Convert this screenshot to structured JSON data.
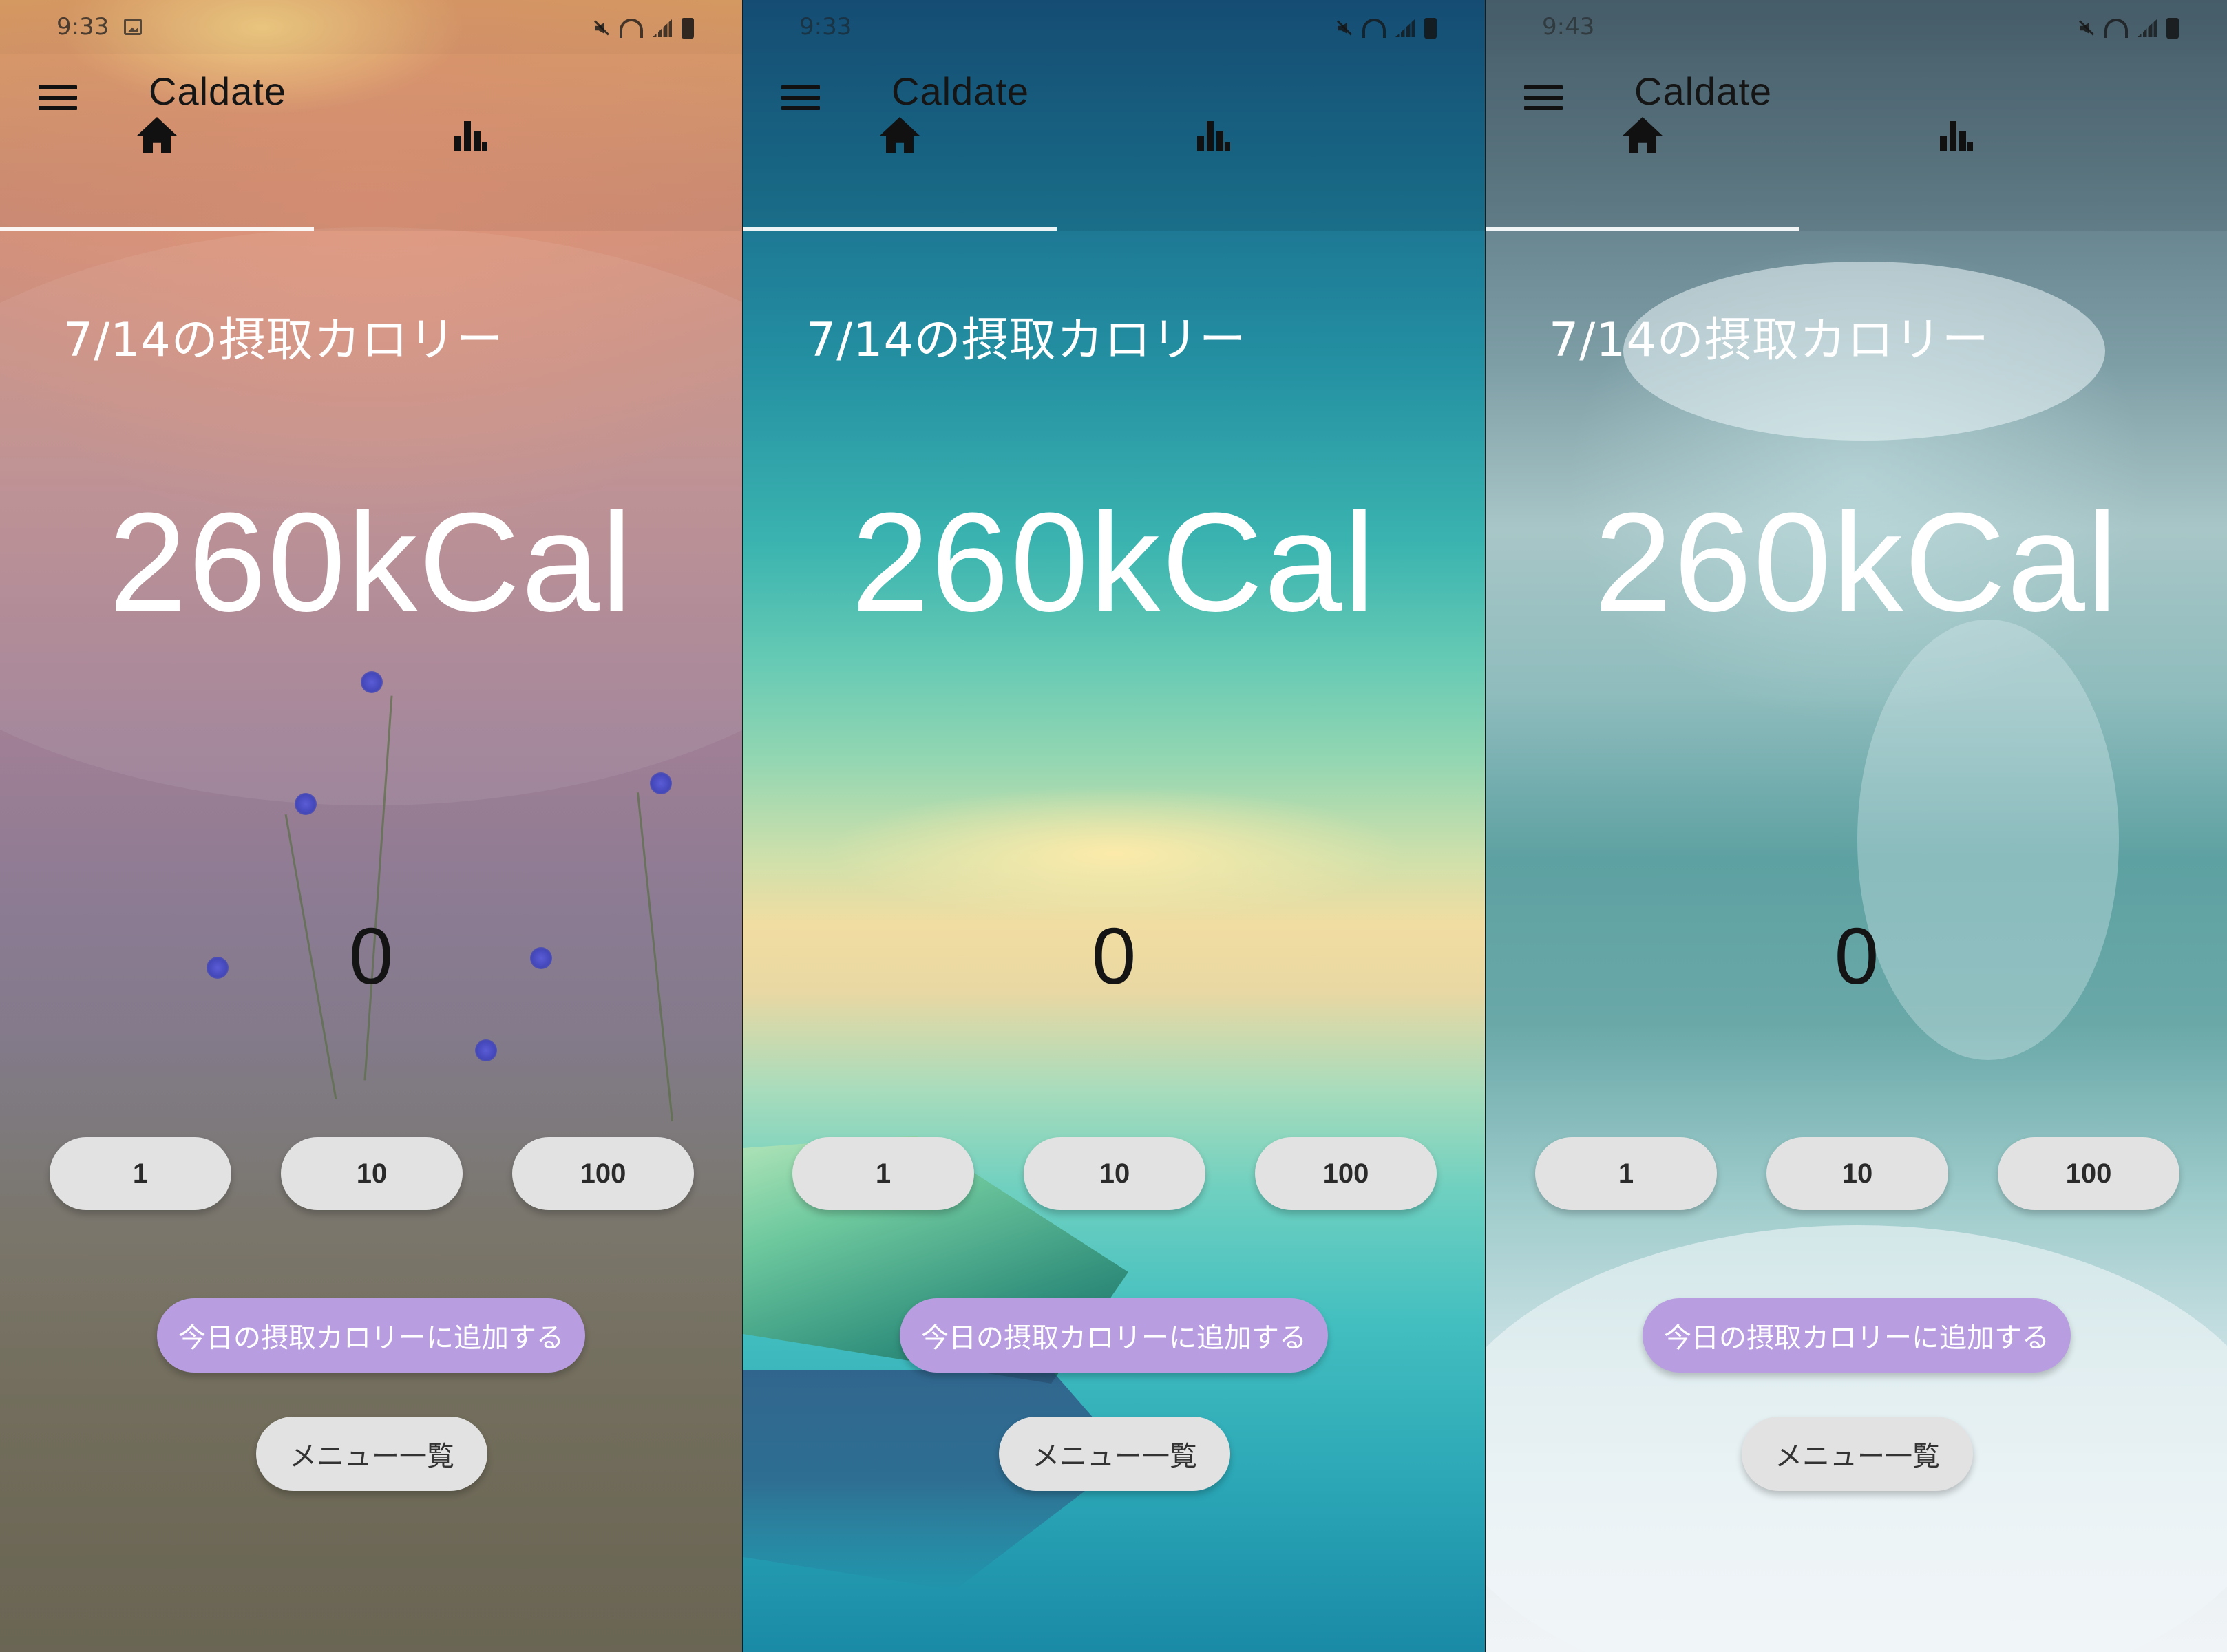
{
  "screens": [
    {
      "status": {
        "time": "9:33"
      },
      "app_title": "Caldate",
      "tabs": [
        {
          "icon": "home-icon"
        },
        {
          "icon": "bar-chart-icon"
        }
      ],
      "heading": "7/14の摂取カロリー",
      "calories": "260kCal",
      "counter": "0",
      "increment_buttons": [
        "1",
        "10",
        "100"
      ],
      "add_button": "今日の摂取カロリーに追加する",
      "menu_button": "メニュー一覧",
      "background": "sunset-flower-field"
    },
    {
      "status": {
        "time": "9:33"
      },
      "app_title": "Caldate",
      "tabs": [
        {
          "icon": "home-icon"
        },
        {
          "icon": "bar-chart-icon"
        }
      ],
      "heading": "7/14の摂取カロリー",
      "calories": "260kCal",
      "counter": "0",
      "increment_buttons": [
        "1",
        "10",
        "100"
      ],
      "add_button": "今日の摂取カロリーに追加する",
      "menu_button": "メニュー一覧",
      "background": "lake-boat"
    },
    {
      "status": {
        "time": "9:43"
      },
      "app_title": "Caldate",
      "tabs": [
        {
          "icon": "home-icon"
        },
        {
          "icon": "bar-chart-icon"
        }
      ],
      "heading": "7/14の摂取カロリー",
      "calories": "260kCal",
      "counter": "0",
      "increment_buttons": [
        "1",
        "10",
        "100"
      ],
      "add_button": "今日の摂取カロリーに追加する",
      "menu_button": "メニュー一覧",
      "background": "ocean-wave"
    }
  ],
  "colors": {
    "add_button": "#b89ee0",
    "pill_button": "#e2e2e2",
    "tab_indicator": "#ffffff",
    "heading_text": "#ffffff",
    "counter_text": "#141414"
  }
}
